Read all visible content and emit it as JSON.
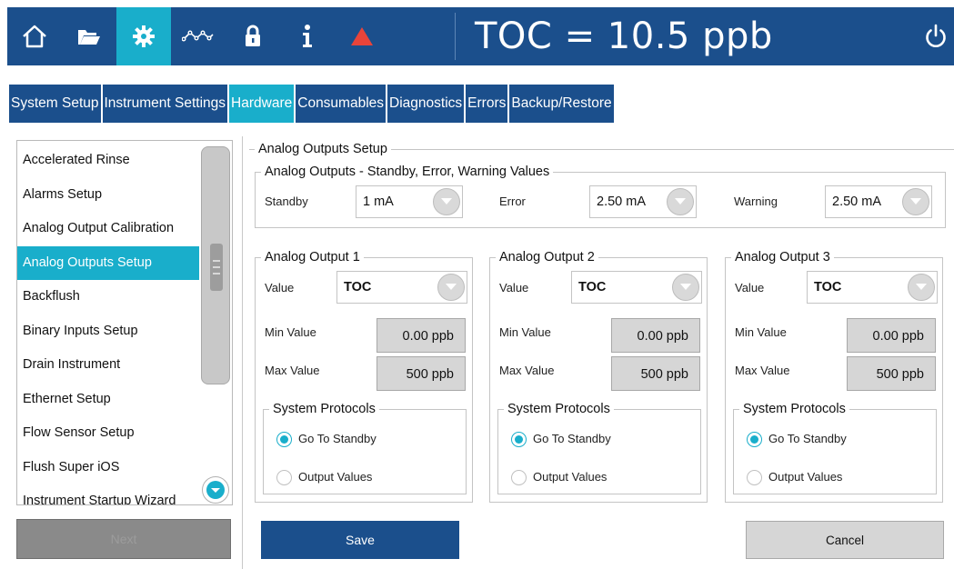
{
  "header": {
    "toc_reading": "TOC = 10.5 ppb",
    "icons": [
      "home-icon",
      "folder-icon",
      "gear-icon",
      "trend-icon",
      "lock-icon",
      "info-icon",
      "alarm-triangle-icon",
      "power-icon"
    ],
    "active_icon": "gear-icon"
  },
  "colors": {
    "primary": "#1b4f8c",
    "accent": "#19aecb",
    "alarm": "#e8443a"
  },
  "tabs": [
    {
      "label": "System Setup"
    },
    {
      "label": "Instrument Settings"
    },
    {
      "label": "Hardware"
    },
    {
      "label": "Consumables"
    },
    {
      "label": "Diagnostics"
    },
    {
      "label": "Errors"
    },
    {
      "label": "Backup/Restore"
    }
  ],
  "active_tab": "Hardware",
  "sidebar": {
    "items": [
      {
        "label": "Accelerated Rinse"
      },
      {
        "label": "Alarms Setup"
      },
      {
        "label": "Analog Output Calibration"
      },
      {
        "label": "Analog Outputs Setup"
      },
      {
        "label": "Backflush"
      },
      {
        "label": "Binary Inputs Setup"
      },
      {
        "label": "Drain Instrument"
      },
      {
        "label": "Ethernet Setup"
      },
      {
        "label": "Flow Sensor Setup"
      },
      {
        "label": "Flush Super iOS"
      },
      {
        "label": "Instrument Startup Wizard"
      }
    ],
    "selected": "Analog Outputs Setup",
    "button_label": "Next"
  },
  "main": {
    "section_title": "Analog Outputs Setup",
    "standby_group": {
      "title": "Analog Outputs - Standby, Error, Warning Values",
      "standby_label": "Standby",
      "standby_value": "1 mA",
      "error_label": "Error",
      "error_value": "2.50 mA",
      "warning_label": "Warning",
      "warning_value": "2.50 mA"
    },
    "outputs": [
      {
        "title": "Analog Output 1",
        "value_label": "Value",
        "value": "TOC",
        "min_label": "Min Value",
        "min_value": "0.00 ppb",
        "max_label": "Max Value",
        "max_value": "500 ppb",
        "protocols_title": "System Protocols",
        "option1": "Go To Standby",
        "option2": "Output Values",
        "selected_option": "Go To Standby"
      },
      {
        "title": "Analog Output 2",
        "value_label": "Value",
        "value": "TOC",
        "min_label": "Min Value",
        "min_value": "0.00 ppb",
        "max_label": "Max Value",
        "max_value": "500 ppb",
        "protocols_title": "System Protocols",
        "option1": "Go To Standby",
        "option2": "Output Values",
        "selected_option": "Go To Standby"
      },
      {
        "title": "Analog Output 3",
        "value_label": "Value",
        "value": "TOC",
        "min_label": "Min Value",
        "min_value": "0.00 ppb",
        "max_label": "Max Value",
        "max_value": "500 ppb",
        "protocols_title": "System Protocols",
        "option1": "Go To Standby",
        "option2": "Output Values",
        "selected_option": "Go To Standby"
      }
    ],
    "save_label": "Save",
    "cancel_label": "Cancel"
  }
}
